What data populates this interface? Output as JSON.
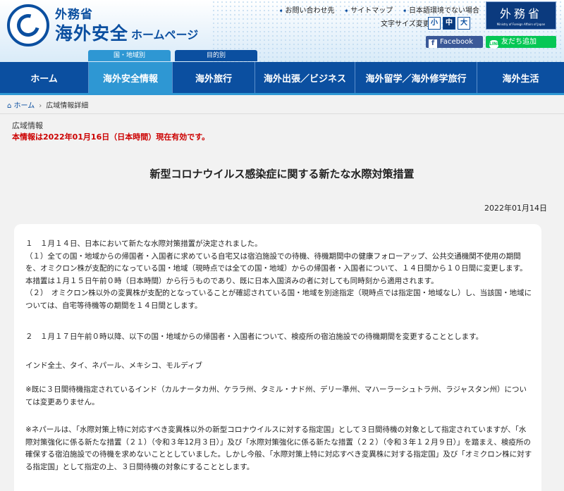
{
  "header": {
    "logo_line1": "外務省",
    "logo_line2": "海外安全",
    "logo_line3": "ホームページ",
    "links": [
      "お問い合わせ先",
      "サイトマップ",
      "日本語環境でない場合"
    ],
    "font_size_label": "文字サイズ変更",
    "font_sizes": [
      "小",
      "中",
      "大"
    ],
    "mofa_title": "外務省",
    "mofa_subtitle": "Ministry of Foreign Affairs of Japan",
    "facebook_label": "Facebook",
    "line_label": "友だち追加",
    "line_icon_text": "LINE",
    "category_tabs": [
      "国・地域別",
      "目的別"
    ]
  },
  "nav": {
    "items": [
      "ホーム",
      "海外安全情報",
      "海外旅行",
      "海外出張／ビジネス",
      "海外留学／海外修学旅行",
      "海外生活"
    ]
  },
  "breadcrumb": {
    "home": "ホーム",
    "current": "広域情報詳細"
  },
  "page": {
    "category": "広域情報",
    "validity": "本情報は2022年01月16日（日本時間）現在有効です。",
    "title": "新型コロナウイルス感染症に関する新たな水際対策措置",
    "date": "2022年01月14日",
    "paragraphs": [
      "１　１月１４日、日本において新たな水際対策措置が決定されました。",
      "（１）全ての国・地域からの帰国者・入国者に求めている自宅又は宿泊施設での待機、待機期間中の健康フォローアップ、公共交通機関不使用の期間を、オミクロン株が支配的になっている国・地域（現時点では全ての国・地域）からの帰国者・入国者について、１４日間から１０日間に変更します。本措置は１月１５日午前０時（日本時間）から行うものであり、既に日本入国済みの者に対しても同時刻から適用されます。",
      "（２）　オミクロン株以外の変異株が支配的となっていることが確認されている国・地域を別途指定（現時点では指定国・地域なし）し、当該国・地域については、自宅等待機等の期間を１４日間とします。",
      "２　１月１７日午前０時以降、以下の国・地域からの帰国者・入国者について、検疫所の宿泊施設での待機期間を変更することとします。",
      "インド全土、タイ、ネパール、メキシコ、モルディブ",
      "※既に３日間待機指定されているインド（カルナータカ州、ケララ州、タミル・ナド州、デリー準州、マハーラーシュトラ州、ラジャスタン州）については変更ありません。",
      "※ネパールは、「水際対策上特に対応すべき変異株以外の新型コロナウイルスに対する指定国」として３日間待機の対象として指定されていますが、「水際対策強化に係る新たな措置（２１）（令和３年12月３日）」及び「水際対策強化に係る新たな措置（２２）（令和３年１２月９日）」を踏まえ、検疫所の確保する宿泊施設での待機を求めないこととしていました。しかし今般、「水際対策上特に対応すべき変異株に対する指定国」及び「オミクロン株に対する指定国」として指定の上、３日間待機の対象にすることとします。"
    ]
  }
}
